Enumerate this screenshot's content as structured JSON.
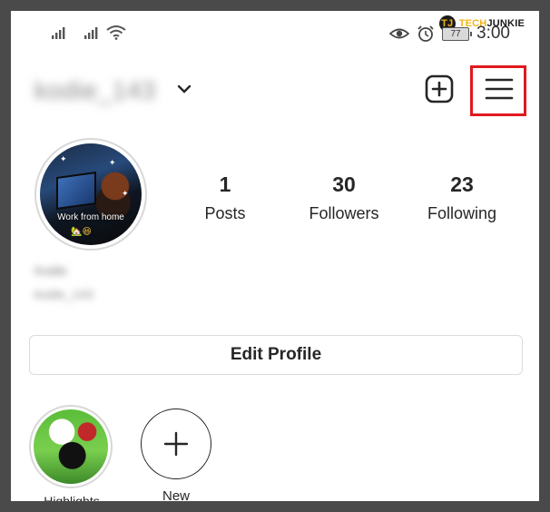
{
  "watermark": {
    "logo": "TJ",
    "part1": "TECH",
    "part2": "JUNKIE"
  },
  "status_bar": {
    "battery": "77",
    "time": "3:00"
  },
  "header": {
    "username": "kodie_143"
  },
  "profile": {
    "avatar_caption": "Work from home",
    "avatar_emoji": "🏡😆",
    "stats": [
      {
        "count": "1",
        "label": "Posts"
      },
      {
        "count": "30",
        "label": "Followers"
      },
      {
        "count": "23",
        "label": "Following"
      }
    ],
    "bio_name": "Kodie",
    "bio_handle": "kodie_143"
  },
  "edit_profile_label": "Edit Profile",
  "highlights": [
    {
      "label": "Highlights"
    },
    {
      "label": "New"
    }
  ],
  "colors": {
    "highlight_box": "#e0191e",
    "text": "#262626"
  }
}
